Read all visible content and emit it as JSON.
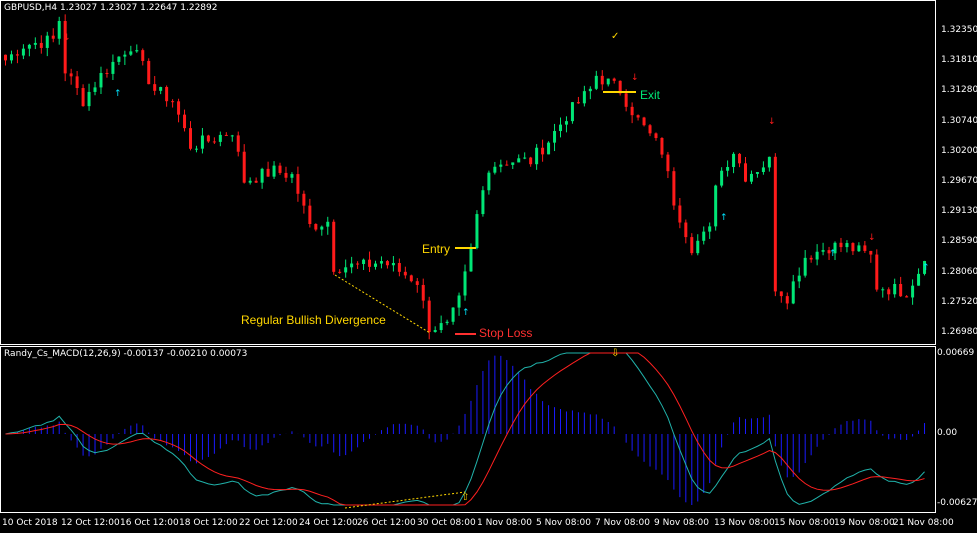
{
  "main_header": "GBPUSD,H4  1.23027 1.23027 1.22647 1.22892",
  "indicator_header": "Randy_Cs_MACD(12,26,9) -0.00137 -0.00210 0.00073",
  "price_axis": [
    "1.32350",
    "1.31810",
    "1.31280",
    "1.30740",
    "1.30200",
    "1.29670",
    "1.29130",
    "1.28590",
    "1.28060",
    "1.27520",
    "1.26980"
  ],
  "indicator_axis": [
    "0.00669",
    "0.00",
    "-0.00627"
  ],
  "time_axis": [
    "10 Oct 2018",
    "12 Oct 12:00",
    "16 Oct 12:00",
    "18 Oct 12:00",
    "22 Oct 12:00",
    "24 Oct 12:00",
    "26 Oct 12:00",
    "30 Oct 08:00",
    "1 Nov 08:00",
    "5 Nov 08:00",
    "7 Nov 08:00",
    "9 Nov 08:00",
    "13 Nov 08:00",
    "15 Nov 08:00",
    "19 Nov 08:00",
    "21 Nov 08:00"
  ],
  "annotations": {
    "entry": "Entry",
    "stop_loss": "Stop Loss",
    "exit": "Exit",
    "divergence": "Regular Bullish Divergence"
  },
  "colors": {
    "bull": "#00e676",
    "bear": "#ff1a1a",
    "macd": "#20b2aa",
    "signal": "#ff2020",
    "histogram": "#1a1aff",
    "annotation": "#ffd700",
    "exit": "#00e676",
    "stop": "#ff3030",
    "axis": "#ffffff"
  },
  "chart_data": {
    "type": "candlestick",
    "symbol": "GBPUSD",
    "timeframe": "H4",
    "ylim": [
      1.2698,
      1.3235
    ],
    "close_path": [
      [
        0,
        1.3183
      ],
      [
        3,
        1.321
      ],
      [
        8,
        1.3219
      ],
      [
        9,
        1.3255
      ],
      [
        10,
        1.3165
      ],
      [
        13,
        1.3112
      ],
      [
        16,
        1.3156
      ],
      [
        20,
        1.3201
      ],
      [
        21,
        1.321
      ],
      [
        25,
        1.313
      ],
      [
        28,
        1.3112
      ],
      [
        31,
        1.3031
      ],
      [
        34,
        1.304
      ],
      [
        38,
        1.3058
      ],
      [
        40,
        1.2969
      ],
      [
        45,
        1.2986
      ],
      [
        48,
        1.2978
      ],
      [
        51,
        1.2888
      ],
      [
        54,
        1.2897
      ],
      [
        55,
        1.2817
      ],
      [
        60,
        1.2817
      ],
      [
        63,
        1.2826
      ],
      [
        66,
        1.2808
      ],
      [
        69,
        1.279
      ],
      [
        71,
        1.2709
      ],
      [
        74,
        1.2709
      ],
      [
        76,
        1.2754
      ],
      [
        78,
        1.2843
      ],
      [
        79,
        1.2906
      ],
      [
        81,
        1.2995
      ],
      [
        84,
        1.3004
      ],
      [
        88,
        1.3004
      ],
      [
        91,
        1.304
      ],
      [
        94,
        1.3085
      ],
      [
        98,
        1.313
      ],
      [
        99,
        1.3156
      ],
      [
        103,
        1.313
      ],
      [
        106,
        1.3076
      ],
      [
        110,
        1.3022
      ],
      [
        112,
        1.2933
      ],
      [
        115,
        1.2852
      ],
      [
        118,
        1.2879
      ],
      [
        119,
        1.2969
      ],
      [
        122,
        1.3022
      ],
      [
        124,
        1.2978
      ],
      [
        128,
        1.3004
      ],
      [
        129,
        1.2781
      ],
      [
        131,
        1.2763
      ],
      [
        134,
        1.2834
      ],
      [
        138,
        1.2852
      ],
      [
        141,
        1.2852
      ],
      [
        145,
        1.2834
      ],
      [
        146,
        1.2781
      ],
      [
        151,
        1.2772
      ],
      [
        154,
        1.2826
      ]
    ],
    "indicator": {
      "name": "MACD",
      "params": [
        12,
        26,
        9
      ],
      "ylim": [
        -0.00627,
        0.00669
      ]
    }
  }
}
